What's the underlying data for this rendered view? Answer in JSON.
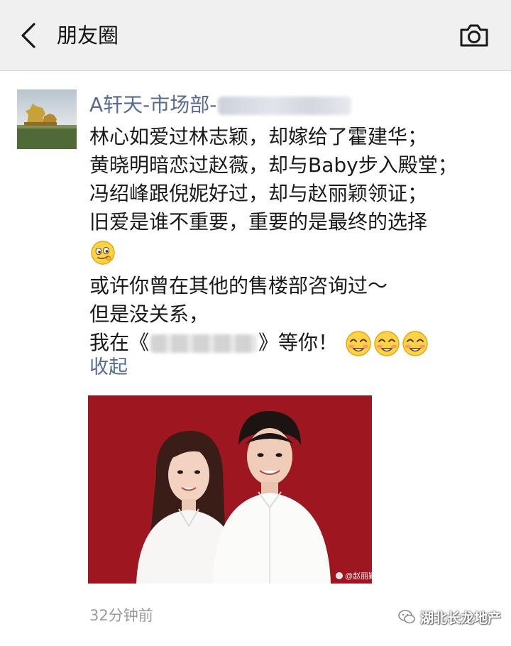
{
  "header": {
    "title": "朋友圈",
    "back_icon": "chevron-left-icon",
    "camera_icon": "camera-icon",
    "background": "#f0f0f0"
  },
  "post": {
    "username": "A轩天-市场部-",
    "username_color": "#576b95",
    "lines": [
      "林心如爱过林志颖，却嫁给了霍建华；",
      "黄晓明暗恋过赵薇，却与Baby步入殿堂；",
      "冯绍峰跟倪妮好过，却与赵丽颖领证；",
      "旧爱是谁不重要，重要的是最终的选择",
      "或许你曾在其他的售楼部咨询过～",
      "但是没关系，"
    ],
    "last_line_prefix": "我在《",
    "last_line_suffix": "》等你！",
    "emoji_after_line4": "smirk-emoji",
    "emoji_last_line": [
      "blush-emoji",
      "blush-emoji",
      "blush-emoji"
    ],
    "collapse_label": "收起",
    "photo_caption": "@赵丽颖",
    "photo_background": "#a31922",
    "timestamp": "32分钟前"
  },
  "watermark": {
    "text": "湖北长龙地产",
    "icon": "wechat-account-icon"
  }
}
